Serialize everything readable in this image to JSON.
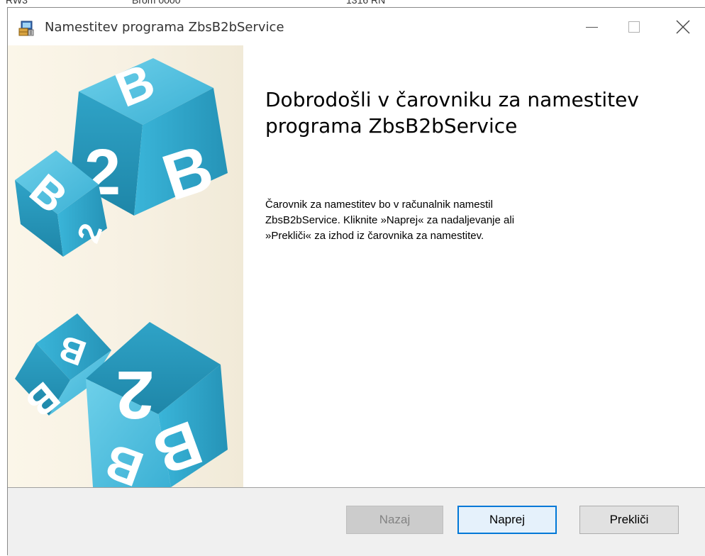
{
  "window": {
    "title": "Namestitev programa ZbsB2bService"
  },
  "background_fragments": [
    "RW3",
    "Brom 0000",
    "1316 RN"
  ],
  "welcome": {
    "heading_line1": "Dobrodošli v čarovniku za namestitev",
    "heading_line2": "programa ZbsB2bService",
    "body_line1": "Čarovnik za namestitev bo v računalnik namestil",
    "body_line2": "ZbsB2bService. Kliknite »Naprej« za nadaljevanje ali",
    "body_line3": "»Prekliči« za izhod iz čarovnika za namestitev."
  },
  "buttons": {
    "back": "Nazaj",
    "next": "Naprej",
    "cancel": "Prekliči"
  },
  "colors": {
    "cube_blue": "#2fa3c7",
    "accent": "#0078d7",
    "button_face": "#e1e1e1",
    "footer": "#f0f0f0"
  },
  "icons": {
    "app": "installer-icon",
    "minimize": "minimize-icon",
    "maximize": "maximize-icon",
    "close": "close-icon"
  }
}
